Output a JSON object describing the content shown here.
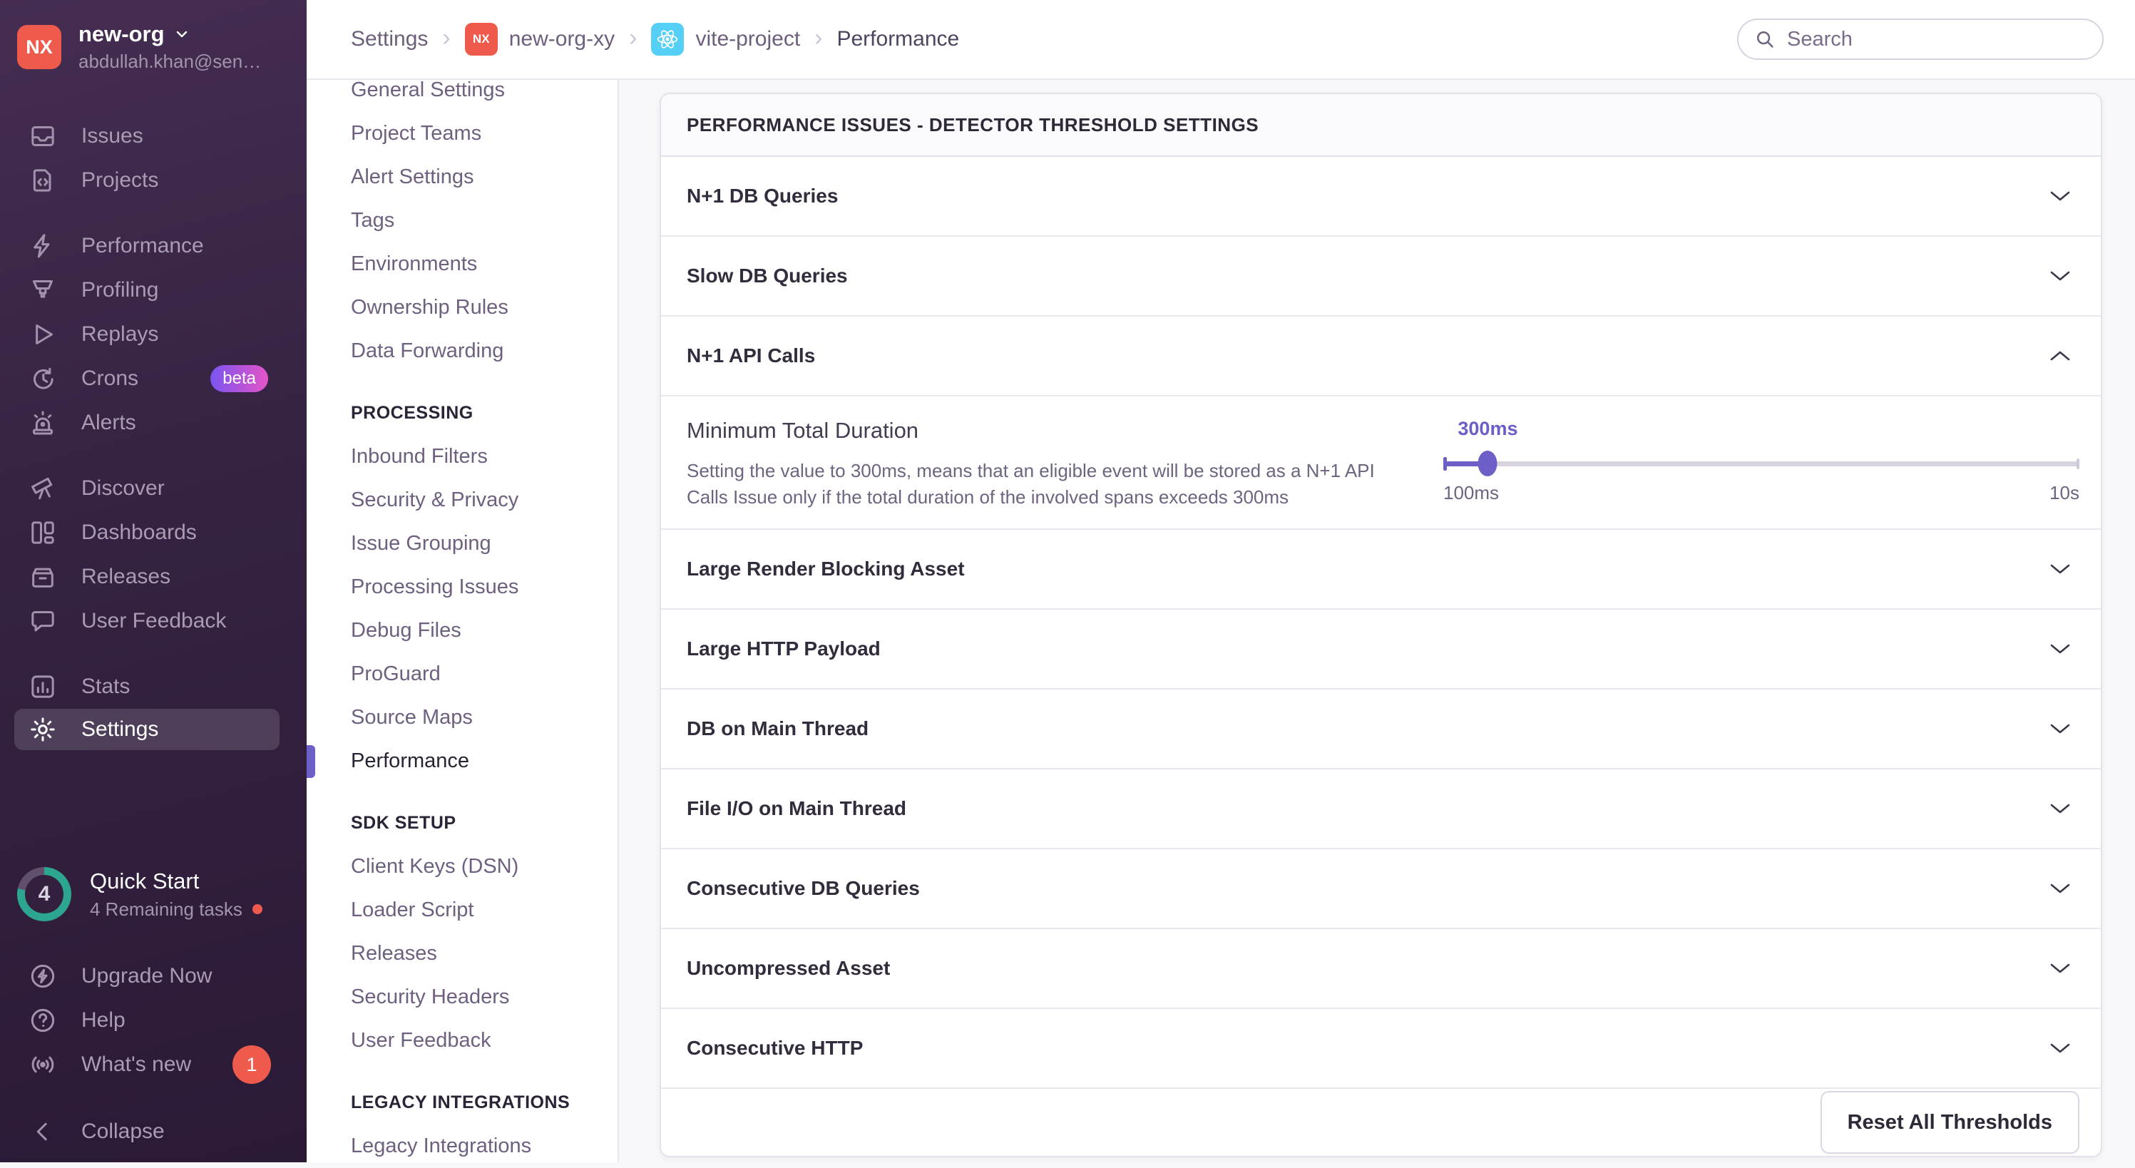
{
  "colors": {
    "accent_purple": "#6C5FC7",
    "sidebar_top": "#452D52",
    "sidebar_bottom": "#2B1A36",
    "org_avatar_red": "#EE5B4D",
    "react_cyan": "#56CFF7",
    "beta_gradient_start": "#7A55EF",
    "beta_gradient_end": "#E554C8",
    "notification_red": "#EE5B4D",
    "progress_teal": "#2DA690"
  },
  "sidebar": {
    "org": {
      "initials": "NX",
      "name": "new-org",
      "email": "abdullah.khan@sen…"
    },
    "nav": [
      {
        "label": "Issues",
        "icon": "issues-icon"
      },
      {
        "label": "Projects",
        "icon": "projects-icon"
      },
      {
        "label": "Performance",
        "icon": "performance-icon"
      },
      {
        "label": "Profiling",
        "icon": "profiling-icon"
      },
      {
        "label": "Replays",
        "icon": "replays-icon"
      },
      {
        "label": "Crons",
        "icon": "crons-icon",
        "badge": "beta"
      },
      {
        "label": "Alerts",
        "icon": "alerts-icon"
      },
      {
        "label": "Discover",
        "icon": "discover-icon"
      },
      {
        "label": "Dashboards",
        "icon": "dashboards-icon"
      },
      {
        "label": "Releases",
        "icon": "releases-icon"
      },
      {
        "label": "User Feedback",
        "icon": "user-feedback-icon"
      },
      {
        "label": "Stats",
        "icon": "stats-icon"
      },
      {
        "label": "Settings",
        "icon": "settings-icon",
        "active": true
      }
    ],
    "quick_start": {
      "title": "Quick Start",
      "subtitle": "4 Remaining tasks",
      "progress_count": "4"
    },
    "footer_nav": [
      {
        "label": "Upgrade Now",
        "icon": "upgrade-icon"
      },
      {
        "label": "Help",
        "icon": "help-icon"
      },
      {
        "label": "What's new",
        "icon": "whats-new-icon",
        "badge": "1"
      }
    ],
    "collapse_label": "Collapse"
  },
  "header": {
    "breadcrumb": {
      "crumbs": [
        "Settings",
        "new-org-xy",
        "vite-project",
        "Performance"
      ]
    },
    "search_placeholder": "Search"
  },
  "settings_nav": {
    "project_items": [
      "General Settings",
      "Project Teams",
      "Alert Settings",
      "Tags",
      "Environments",
      "Ownership Rules",
      "Data Forwarding"
    ],
    "sections": [
      {
        "title": "PROCESSING",
        "items": [
          "Inbound Filters",
          "Security & Privacy",
          "Issue Grouping",
          "Processing Issues",
          "Debug Files",
          "ProGuard",
          "Source Maps",
          "Performance"
        ]
      },
      {
        "title": "SDK SETUP",
        "items": [
          "Client Keys (DSN)",
          "Loader Script",
          "Releases",
          "Security Headers",
          "User Feedback"
        ]
      },
      {
        "title": "LEGACY INTEGRATIONS",
        "items": [
          "Legacy Integrations"
        ]
      }
    ],
    "active_item": "Performance"
  },
  "panel": {
    "title": "PERFORMANCE ISSUES - DETECTOR THRESHOLD SETTINGS",
    "rows": [
      "N+1 DB Queries",
      "Slow DB Queries",
      "N+1 API Calls",
      "Large Render Blocking Asset",
      "Large HTTP Payload",
      "DB on Main Thread",
      "File I/O on Main Thread",
      "Consecutive DB Queries",
      "Uncompressed Asset",
      "Consecutive HTTP"
    ],
    "expanded_row": "N+1 API Calls",
    "detail": {
      "title": "Minimum Total Duration",
      "description": "Setting the value to 300ms, means that an eligible event will be stored as a N+1 API Calls Issue only if the total duration of the involved spans exceeds 300ms",
      "slider": {
        "value": "300ms",
        "min": "100ms",
        "max": "10s",
        "percent": 7
      }
    },
    "reset_button_label": "Reset All Thresholds"
  }
}
